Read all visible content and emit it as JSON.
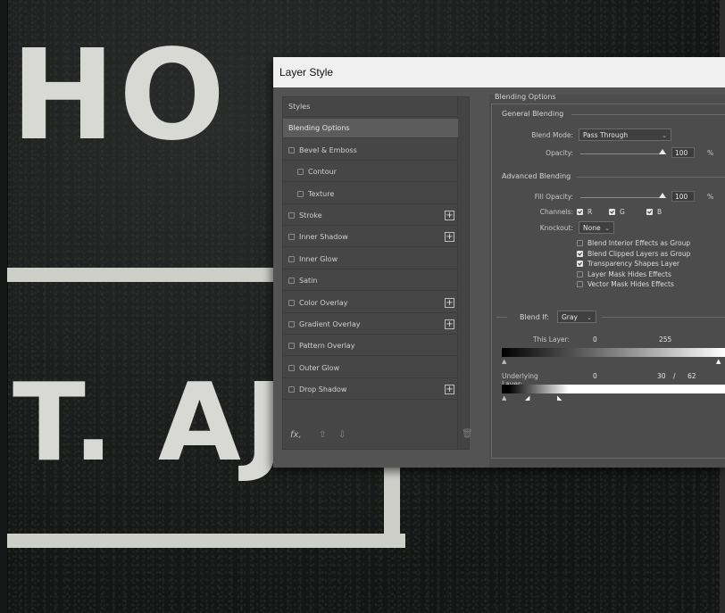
{
  "background": {
    "text_top": "HO",
    "text_bottom": "T. AJ"
  },
  "dialog": {
    "title": "Layer Style",
    "styles_list": [
      {
        "label": "Styles",
        "checkbox": false,
        "plus": false,
        "selected": false,
        "indent": false
      },
      {
        "label": "Blending Options",
        "checkbox": false,
        "plus": false,
        "selected": true,
        "indent": false
      },
      {
        "label": "Bevel & Emboss",
        "checkbox": true,
        "plus": false,
        "selected": false,
        "indent": false
      },
      {
        "label": "Contour",
        "checkbox": true,
        "plus": false,
        "selected": false,
        "indent": true
      },
      {
        "label": "Texture",
        "checkbox": true,
        "plus": false,
        "selected": false,
        "indent": true
      },
      {
        "label": "Stroke",
        "checkbox": true,
        "plus": true,
        "selected": false,
        "indent": false
      },
      {
        "label": "Inner Shadow",
        "checkbox": true,
        "plus": true,
        "selected": false,
        "indent": false
      },
      {
        "label": "Inner Glow",
        "checkbox": true,
        "plus": false,
        "selected": false,
        "indent": false
      },
      {
        "label": "Satin",
        "checkbox": true,
        "plus": false,
        "selected": false,
        "indent": false
      },
      {
        "label": "Color Overlay",
        "checkbox": true,
        "plus": true,
        "selected": false,
        "indent": false
      },
      {
        "label": "Gradient Overlay",
        "checkbox": true,
        "plus": true,
        "selected": false,
        "indent": false
      },
      {
        "label": "Pattern Overlay",
        "checkbox": true,
        "plus": false,
        "selected": false,
        "indent": false
      },
      {
        "label": "Outer Glow",
        "checkbox": true,
        "plus": false,
        "selected": false,
        "indent": false
      },
      {
        "label": "Drop Shadow",
        "checkbox": true,
        "plus": true,
        "selected": false,
        "indent": false
      }
    ],
    "footer": {
      "fx_label": "fx,",
      "up_icon": "arrow-up-icon",
      "down_icon": "arrow-down-icon",
      "trash_icon": "trash-icon"
    },
    "blending": {
      "section_title": "Blending Options",
      "general_title": "General Blending",
      "blend_mode_label": "Blend Mode:",
      "blend_mode_value": "Pass Through",
      "opacity_label": "Opacity:",
      "opacity_value": "100",
      "opacity_unit": "%",
      "advanced_title": "Advanced Blending",
      "fill_opacity_label": "Fill Opacity:",
      "fill_opacity_value": "100",
      "fill_opacity_unit": "%",
      "channels_label": "Channels:",
      "channel_r": "R",
      "channel_g": "G",
      "channel_b": "B",
      "knockout_label": "Knockout:",
      "knockout_value": "None",
      "options": [
        {
          "label": "Blend Interior Effects as Group",
          "checked": false
        },
        {
          "label": "Blend Clipped Layers as Group",
          "checked": true
        },
        {
          "label": "Transparency Shapes Layer",
          "checked": true
        },
        {
          "label": "Layer Mask Hides Effects",
          "checked": false
        },
        {
          "label": "Vector Mask Hides Effects",
          "checked": false
        }
      ],
      "blend_if_label": "Blend If:",
      "blend_if_value": "Gray",
      "this_layer_label": "This Layer:",
      "this_layer_low": "0",
      "this_layer_high": "255",
      "underlying_label": "Underlying Layer:",
      "underlying_low": "0",
      "underlying_mid": "30",
      "underlying_sep": "/",
      "underlying_high": "62"
    }
  }
}
